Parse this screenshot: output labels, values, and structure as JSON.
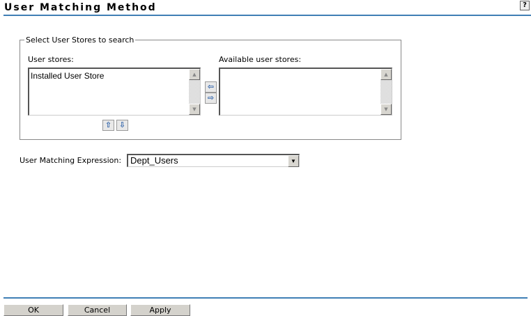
{
  "header": {
    "title": "User Matching Method",
    "help_label": "?"
  },
  "fieldset": {
    "legend": "Select User Stores to search",
    "user_stores_label": "User stores:",
    "user_stores": [
      "Installed User Store"
    ],
    "available_label": "Available user stores:",
    "available_stores": [],
    "move_left": "⇦",
    "move_right": "⇨",
    "move_up": "⇧",
    "move_down": "⇩"
  },
  "expression": {
    "label": "User Matching Expression:",
    "value": "Dept_Users"
  },
  "footer": {
    "ok": "OK",
    "cancel": "Cancel",
    "apply": "Apply"
  }
}
